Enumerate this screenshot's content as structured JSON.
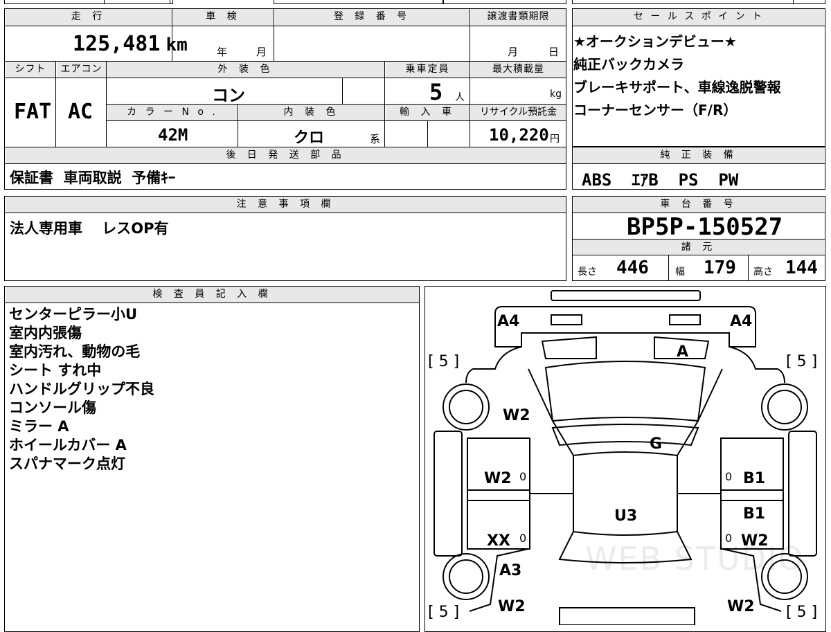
{
  "headers": {
    "mileage": "走 行",
    "shaken": "車 検",
    "registration": "登 録 番 号",
    "transfer_deadline": "譲渡書類期限",
    "sales_points": "セ ー ル ス ポ イ ン ト",
    "shift": "シフト",
    "aircon": "エアコン",
    "exterior_color": "外 装 色",
    "capacity": "乗車定員",
    "max_load": "最大積載量",
    "color_no": "カ ラ ー N o .",
    "interior_color": "内 装 色",
    "import": "輸 入 車",
    "recycle_fee": "リサイクル預託金",
    "later_parts": "後 日 発 送 部 品",
    "standard_equipment": "純 正 装 備",
    "notes": "注 意 事 項 欄",
    "chassis_no": "車 台 番 号",
    "specs": "諸 元",
    "inspector": "検 査 員 記 入 欄"
  },
  "mileage": {
    "value": "125,481",
    "unit": "km"
  },
  "shaken": {
    "year_label": "年",
    "month_label": "月"
  },
  "transfer_deadline": {
    "month_label": "月",
    "day_label": "日"
  },
  "shift": "FAT",
  "aircon": "AC",
  "exterior_color": "コン",
  "capacity": {
    "value": "5",
    "unit": "人"
  },
  "max_load": {
    "value": "",
    "unit": "kg"
  },
  "color_no": "42M",
  "interior_color": {
    "value": "クロ",
    "suffix": "系"
  },
  "recycle_fee": {
    "value": "10,220",
    "unit": "円"
  },
  "later_parts": "保証書  車両取説  予備ｷｰ",
  "sales_points": [
    "★オークションデビュー★",
    "純正バックカメラ",
    "ブレーキサポート、車線逸脱警報",
    "コーナーセンサー（F/R）"
  ],
  "standard_equipment": "ABS  ｴｱB  PS  PW",
  "notes": "法人専用車　 レスOP有",
  "chassis_no": "BP5P-150527",
  "specs": {
    "length_label": "長さ",
    "length": "446",
    "width_label": "幅",
    "width": "179",
    "height_label": "高さ",
    "height": "144"
  },
  "inspector_notes": [
    "センターピラー小U",
    "室内内張傷",
    "室内汚れ、動物の毛",
    "シート すれ中",
    "ハンドルグリップ不良",
    "コンソール傷",
    "ミラー A",
    "ホイールカバー A",
    "スパナマーク点灯"
  ],
  "diagram": {
    "marks": {
      "front_left_corner": "A4",
      "front_right_corner": "A4",
      "windshield": "A",
      "left_front_fender": "W2",
      "hood_right": "G",
      "left_front_door": "W2",
      "right_front_door": "B1",
      "roof": "U3",
      "right_rear_door_upper": "B1",
      "left_rear_door": "XX",
      "right_rear_door": "W2",
      "left_rear_quarter": "A3",
      "left_rear_bottom": "W2",
      "right_rear_bottom": "W2"
    },
    "zeros": [
      "0",
      "0",
      "0",
      "0"
    ],
    "tire_labels": {
      "fl": "[ 5 ]",
      "fr": "[ 5 ]",
      "rl": "[ 5 ]",
      "rr": "[ 5 ]"
    },
    "watermark": "WEB STUDIO"
  }
}
